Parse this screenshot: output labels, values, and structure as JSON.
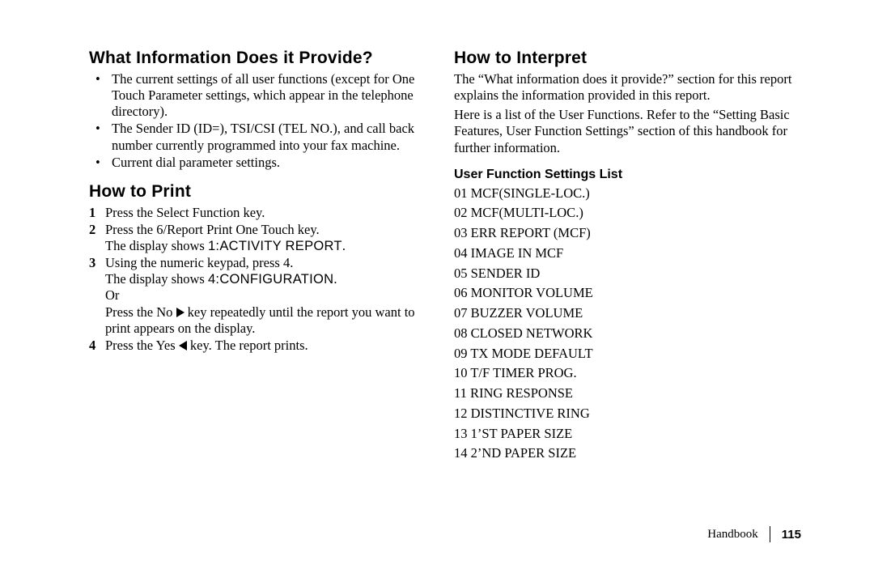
{
  "left": {
    "h_info": "What Information Does it Provide?",
    "bullets": [
      "The current settings of all user functions (except for One Touch Parameter settings, which appear in the telephone directory).",
      "The Sender ID (ID=), TSI/CSI (TEL NO.), and call back number currently programmed into your fax machine.",
      "Current dial parameter settings."
    ],
    "h_print": "How to Print",
    "steps": {
      "s1": "Press the Select Function key.",
      "s2a": "Press the 6/Report Print One Touch key.",
      "s2b_pre": "The display shows ",
      "s2b_label": "1:ACTIVITY REPORT",
      "s2b_post": ".",
      "s3a": "Using the numeric keypad, press 4.",
      "s3b_pre": "The display shows ",
      "s3b_label": "4:CONFIGURATION",
      "s3b_post": ".",
      "s3c": "Or",
      "s3d_pre": "Press the No ",
      "s3d_post": " key repeatedly until the report you want to print appears on the display.",
      "s4_pre": "Press the Yes ",
      "s4_post": " key. The report prints."
    }
  },
  "right": {
    "h_interpret": "How to Interpret",
    "p1": "The “What information does it provide?” section for this report explains the information provided in this report.",
    "p2": "Here is a list of the User Functions. Refer to the “Setting Basic Features, User Function Settings” section of this handbook for further information.",
    "sub": "User Function Settings List",
    "funcs": [
      "01 MCF(SINGLE-LOC.)",
      "02 MCF(MULTI-LOC.)",
      "03 ERR REPORT (MCF)",
      "04 IMAGE IN MCF",
      "05 SENDER ID",
      "06 MONITOR VOLUME",
      "07 BUZZER VOLUME",
      "08 CLOSED NETWORK",
      "09 TX MODE DEFAULT",
      "10 T/F TIMER PROG.",
      "11 RING RESPONSE",
      "12 DISTINCTIVE RING",
      "13 1’ST PAPER SIZE",
      "14 2’ND PAPER SIZE"
    ]
  },
  "footer": {
    "label": "Handbook",
    "page": "115"
  }
}
